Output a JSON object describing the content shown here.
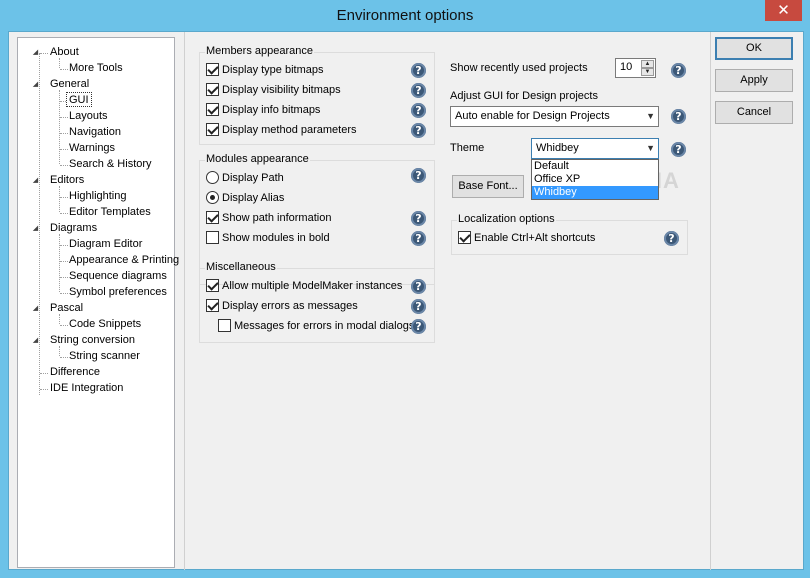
{
  "window": {
    "title": "Environment options",
    "close_glyph": "✕"
  },
  "tree": {
    "items": [
      {
        "label": "About",
        "expander": "◢"
      },
      {
        "label": "More Tools"
      },
      {
        "label": "General",
        "expander": "◢"
      },
      {
        "label": "GUI"
      },
      {
        "label": "Layouts"
      },
      {
        "label": "Navigation"
      },
      {
        "label": "Warnings"
      },
      {
        "label": "Search & History"
      },
      {
        "label": "Editors",
        "expander": "◢"
      },
      {
        "label": "Highlighting"
      },
      {
        "label": "Editor Templates"
      },
      {
        "label": "Diagrams",
        "expander": "◢"
      },
      {
        "label": "Diagram Editor"
      },
      {
        "label": "Appearance & Printing"
      },
      {
        "label": "Sequence diagrams"
      },
      {
        "label": "Symbol preferences"
      },
      {
        "label": "Pascal",
        "expander": "◢"
      },
      {
        "label": "Code Snippets"
      },
      {
        "label": "String conversion",
        "expander": "◢"
      },
      {
        "label": "String scanner"
      },
      {
        "label": "Difference"
      },
      {
        "label": "IDE Integration"
      }
    ]
  },
  "members": {
    "title": "Members appearance",
    "items": [
      {
        "label": "Display type bitmaps",
        "checked": true
      },
      {
        "label": "Display visibility bitmaps",
        "checked": true
      },
      {
        "label": "Display info bitmaps",
        "checked": true
      },
      {
        "label": "Display method parameters",
        "checked": true
      }
    ]
  },
  "modules": {
    "title": "Modules appearance",
    "radios": [
      {
        "label": "Display Path",
        "checked": false
      },
      {
        "label": "Display Alias",
        "checked": true
      }
    ],
    "checks": [
      {
        "label": "Show path information",
        "checked": true
      },
      {
        "label": "Show modules in bold",
        "checked": false
      }
    ]
  },
  "misc": {
    "title": "Miscellaneous",
    "items": [
      {
        "label": "Allow multiple ModelMaker instances",
        "checked": true
      },
      {
        "label": "Display errors as messages",
        "checked": true
      },
      {
        "label": "Messages for errors in modal dialogs",
        "checked": false
      }
    ]
  },
  "recent": {
    "label": "Show recently used projects",
    "value": "10",
    "up": "▲",
    "down": "▼"
  },
  "adjust": {
    "label": "Adjust GUI for Design projects",
    "value": "Auto enable for Design Projects"
  },
  "theme": {
    "label": "Theme",
    "value": "Whidbey",
    "options": [
      "Default",
      "Office XP",
      "Whidbey"
    ],
    "highlighted": "Whidbey"
  },
  "base_font": {
    "label": "Base Font..."
  },
  "localization": {
    "title": "Localization options",
    "item": {
      "label": "Enable Ctrl+Alt shortcuts",
      "checked": true
    }
  },
  "buttons": {
    "ok": "OK",
    "apply": "Apply",
    "cancel": "Cancel"
  },
  "help_glyph": "?",
  "chevron_glyph": "▼",
  "watermark": "SOFTPEDIA"
}
